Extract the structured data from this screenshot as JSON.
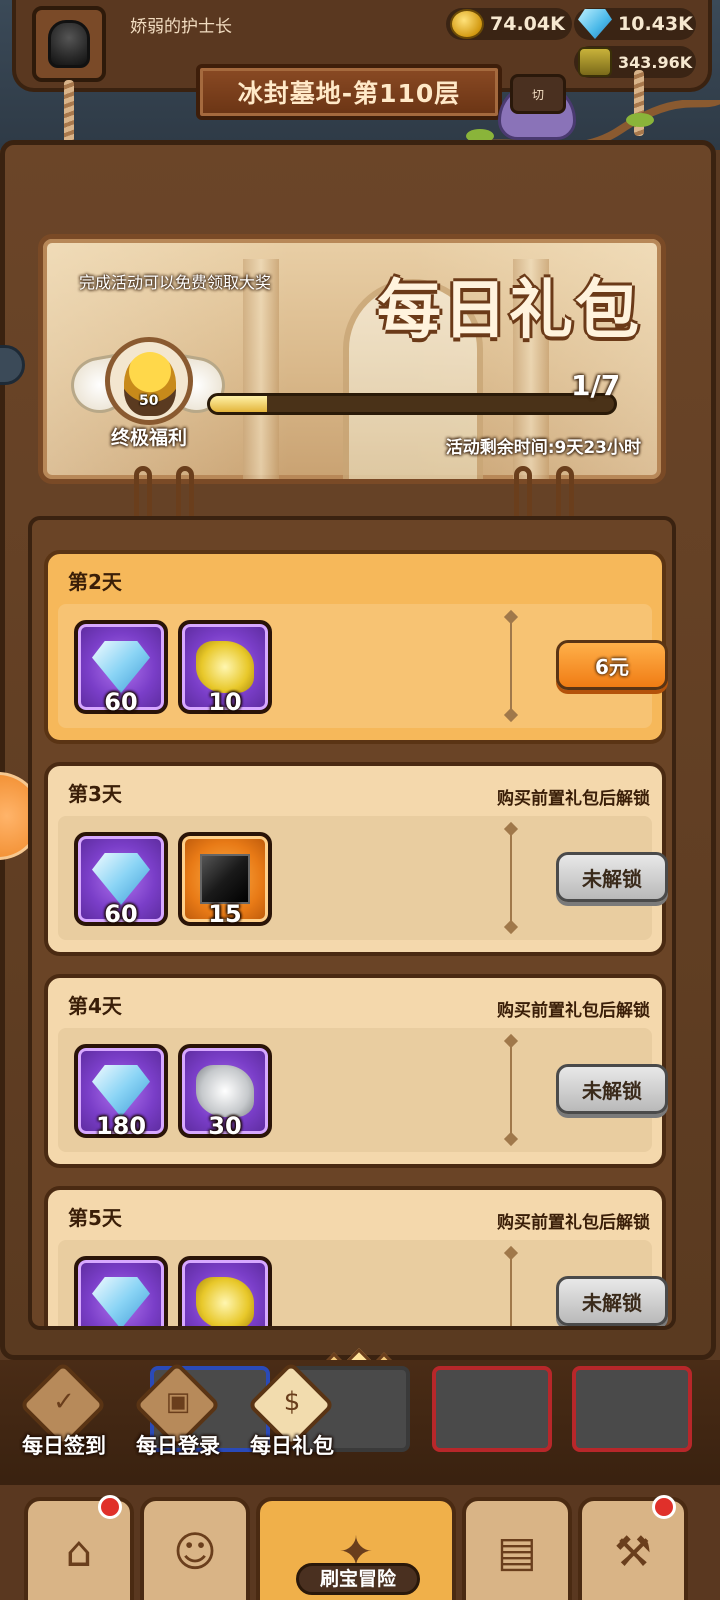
{
  "player": {
    "name": "娇弱的护士长"
  },
  "currencies": [
    {
      "icon": "gold-coin-icon",
      "value": "74.04K"
    },
    {
      "icon": "diamond-icon",
      "value": "10.43K"
    },
    {
      "icon": "jar-icon",
      "value": "343.96K"
    }
  ],
  "stage": {
    "title": "冰封墓地-第110层",
    "switch_label": "切"
  },
  "banner": {
    "subtitle": "完成活动可以免费领取大奖",
    "title": "每日礼包",
    "reward_label": "终极福利",
    "reward_level": "50",
    "progress_text": "1/7",
    "progress_fraction": 0.14,
    "remaining": "活动剩余时间:9天23小时"
  },
  "days": [
    {
      "title": "第2天",
      "hint": "",
      "items": [
        {
          "icon": "diamond-icon",
          "count": "60",
          "rarity": "purple"
        },
        {
          "icon": "gold-scroll-icon",
          "count": "10",
          "rarity": "purple"
        }
      ],
      "button": "6元",
      "button_style": "orange",
      "active": true
    },
    {
      "title": "第3天",
      "hint": "购买前置礼包后解锁",
      "items": [
        {
          "icon": "diamond-icon",
          "count": "60",
          "rarity": "purple"
        },
        {
          "icon": "black-cube-icon",
          "count": "15",
          "rarity": "orange"
        }
      ],
      "button": "未解锁",
      "button_style": "grey",
      "active": false
    },
    {
      "title": "第4天",
      "hint": "购买前置礼包后解锁",
      "items": [
        {
          "icon": "diamond-icon",
          "count": "180",
          "rarity": "purple"
        },
        {
          "icon": "silver-scroll-icon",
          "count": "30",
          "rarity": "purple"
        }
      ],
      "button": "未解锁",
      "button_style": "grey",
      "active": false
    },
    {
      "title": "第5天",
      "hint": "购买前置礼包后解锁",
      "items": [
        {
          "icon": "diamond-icon",
          "count": "",
          "rarity": "purple"
        },
        {
          "icon": "gold-scroll-icon",
          "count": "",
          "rarity": "purple"
        }
      ],
      "button": "未解锁",
      "button_style": "grey",
      "active": false
    }
  ],
  "sub_tabs": [
    {
      "label": "每日签到",
      "icon": "calendar-check-icon",
      "active": false
    },
    {
      "label": "每日登录",
      "icon": "gift-box-icon",
      "active": false
    },
    {
      "label": "每日礼包",
      "icon": "money-bag-icon",
      "active": true
    }
  ],
  "bottom_nav": {
    "center_label": "刷宝冒险",
    "buttons": [
      {
        "icon": "shop-icon",
        "badge": true
      },
      {
        "icon": "hero-icon",
        "badge": false
      },
      {
        "icon": "adventure-map-icon",
        "badge": false
      },
      {
        "icon": "backpack-icon",
        "badge": false
      },
      {
        "icon": "forge-hammer-icon",
        "badge": true
      }
    ]
  },
  "colors": {
    "accent_orange": "#f07c14",
    "card_active": "#f6b85a",
    "card_inactive": "#f4d8ac",
    "item_purple": "#7a3ec8",
    "item_orange": "#e87a16"
  }
}
